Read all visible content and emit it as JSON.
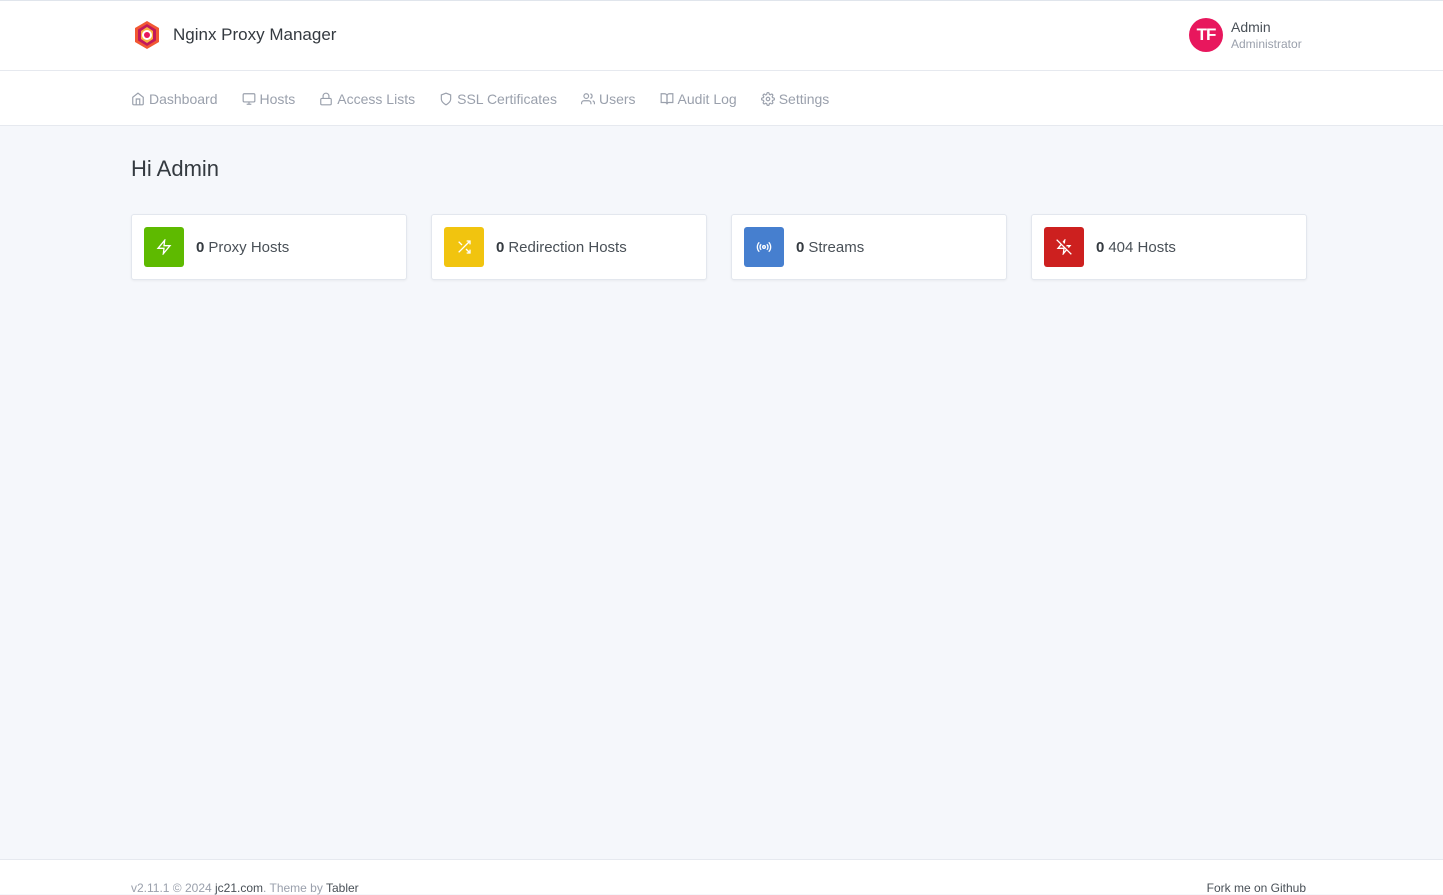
{
  "header": {
    "app_name": "Nginx Proxy Manager",
    "logo_icon": "nginx-proxy-manager-logo",
    "user": {
      "initials": "TF",
      "name": "Admin",
      "role": "Administrator",
      "avatar_color": "#e8175d"
    }
  },
  "nav": {
    "items": [
      {
        "label": "Dashboard",
        "icon": "home-icon"
      },
      {
        "label": "Hosts",
        "icon": "monitor-icon"
      },
      {
        "label": "Access Lists",
        "icon": "lock-icon"
      },
      {
        "label": "SSL Certificates",
        "icon": "shield-icon"
      },
      {
        "label": "Users",
        "icon": "users-icon"
      },
      {
        "label": "Audit Log",
        "icon": "book-icon"
      },
      {
        "label": "Settings",
        "icon": "gear-icon"
      }
    ]
  },
  "main": {
    "greeting": "Hi Admin",
    "cards": [
      {
        "count": "0",
        "label": "Proxy Hosts",
        "color": "#5eba00",
        "icon": "zap-icon"
      },
      {
        "count": "0",
        "label": "Redirection Hosts",
        "color": "#f1c40f",
        "icon": "shuffle-icon"
      },
      {
        "count": "0",
        "label": "Streams",
        "color": "#467fcf",
        "icon": "radio-icon"
      },
      {
        "count": "0",
        "label": "404 Hosts",
        "color": "#cd201f",
        "icon": "zap-off-icon"
      }
    ]
  },
  "footer": {
    "version_prefix": "v2.11.1 © 2024 ",
    "site_link": "jc21.com",
    "theme_prefix": ". Theme by ",
    "theme_link": "Tabler",
    "github_link": "Fork me on Github"
  }
}
